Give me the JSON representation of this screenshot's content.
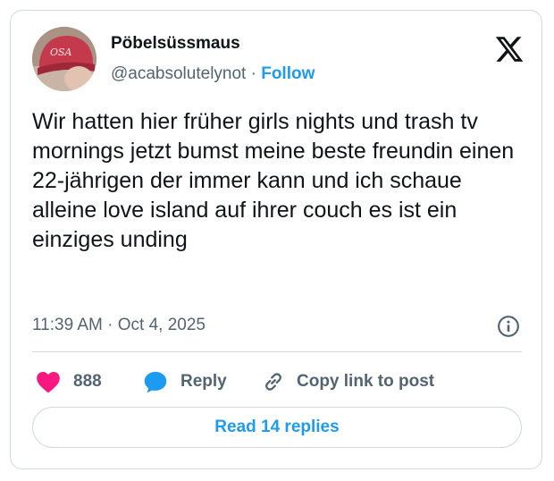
{
  "author": {
    "display_name": "Pöbelsüssmaus",
    "handle": "@acabsolutelynot",
    "separator": "·",
    "follow_label": "Follow",
    "avatar_cap_text": "OSA"
  },
  "tweet": {
    "text": "Wir hatten hier früher girls nights und trash tv mornings jetzt bumst meine beste freundin einen 22-jährigen der immer kann und ich schaue alleine love island auf ihrer couch es ist ein einziges unding",
    "time": "11:39 AM",
    "date_separator": "·",
    "date": "Oct 4, 2025"
  },
  "actions": {
    "like_count": "888",
    "reply_label": "Reply",
    "copy_label": "Copy link to post"
  },
  "read_replies_label": "Read 14 replies",
  "colors": {
    "accent": "#1d9bf0",
    "like": "#f91880",
    "secondary_text": "#536471",
    "border": "#cfd9de"
  },
  "icons": [
    "x-logo-icon",
    "info-icon",
    "heart-icon",
    "reply-bubble-icon",
    "link-icon"
  ]
}
